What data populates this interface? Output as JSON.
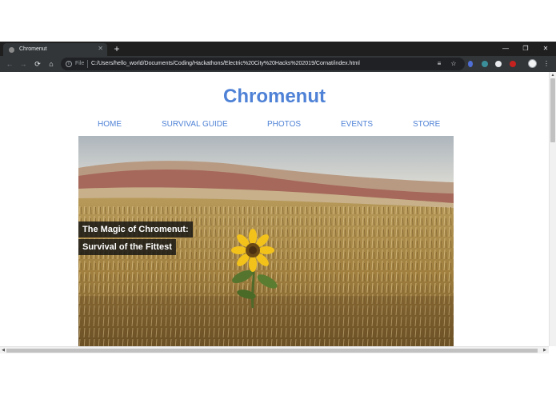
{
  "browser": {
    "tab_title": "Chromenut",
    "tab_close": "✕",
    "new_tab": "+",
    "scheme_label": "File",
    "url": "C:/Users/hello_world/Documents/Coding/Hackathons/Electric%20City%20Hacks%202019/Cornat/index.html",
    "window_controls": {
      "minimize": "—",
      "restore": "❐",
      "close": "✕"
    },
    "nav": {
      "back": "←",
      "forward": "→",
      "reload": "⟳",
      "home": "⌂"
    },
    "toolbar_icons": {
      "reading_list": "≡",
      "bookmark": "☆",
      "menu": "⋮"
    },
    "accent_colors": {
      "brand_blue": "#4f82d6",
      "chrome_dark": "#323639"
    }
  },
  "page": {
    "site_title": "Chromenut",
    "nav_items": [
      "HOME",
      "SURVIVAL GUIDE",
      "PHOTOS",
      "EVENTS",
      "STORE"
    ],
    "hero": {
      "caption_line1": "The Magic of Chromenut:",
      "caption_line2": "Survival of the Fittest"
    }
  }
}
